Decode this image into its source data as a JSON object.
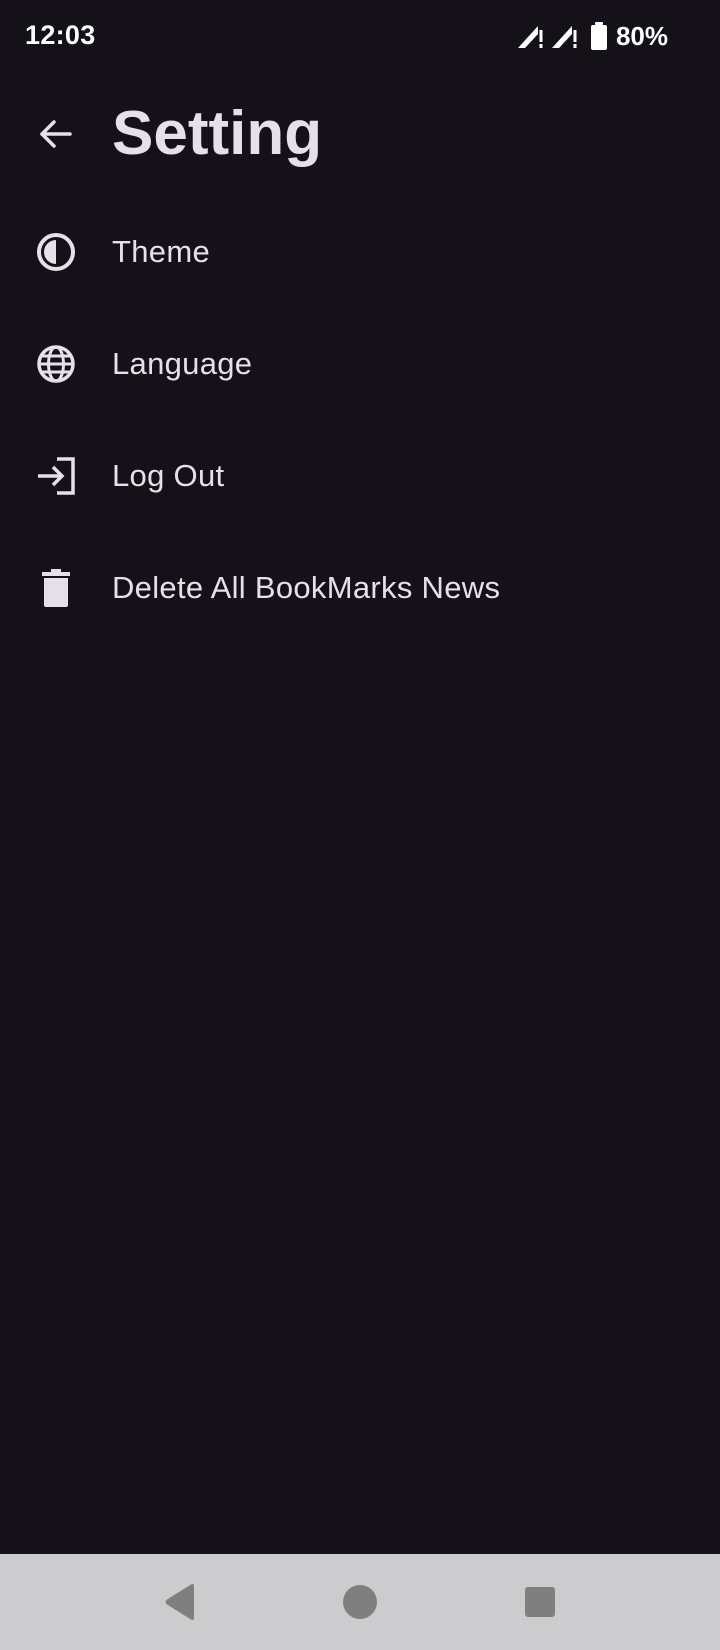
{
  "status_bar": {
    "time": "12:03",
    "battery_percent": "80%",
    "icons": [
      "signal-icon",
      "signal-icon",
      "battery-icon"
    ]
  },
  "app_bar": {
    "title": "Setting",
    "back_icon": "arrow-back-icon"
  },
  "menu": {
    "items": [
      {
        "label": "Theme",
        "icon": "theme-contrast-icon"
      },
      {
        "label": "Language",
        "icon": "globe-icon"
      },
      {
        "label": "Log Out",
        "icon": "logout-icon"
      },
      {
        "label": "Delete All BookMarks News",
        "icon": "trash-icon"
      }
    ]
  },
  "nav_bar": {
    "buttons": [
      "back-triangle-icon",
      "home-circle-icon",
      "recents-square-icon"
    ]
  },
  "colors": {
    "background": "#141218",
    "text": "#E6E0E9",
    "nav_bar": "#CCCCCE",
    "nav_icon": "#7F7F7F"
  }
}
